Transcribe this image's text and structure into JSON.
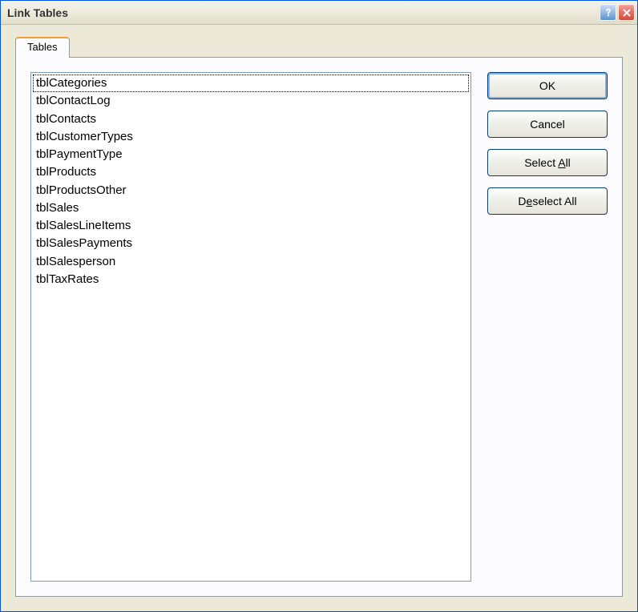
{
  "window": {
    "title": "Link Tables"
  },
  "tabs": {
    "items": [
      {
        "label": "Tables"
      }
    ]
  },
  "list": {
    "items": [
      "tblCategories",
      "tblContactLog",
      "tblContacts",
      "tblCustomerTypes",
      "tblPaymentType",
      "tblProducts",
      "tblProductsOther",
      "tblSales",
      "tblSalesLineItems",
      "tblSalesPayments",
      "tblSalesperson",
      "tblTaxRates"
    ],
    "focused_index": 0
  },
  "buttons": {
    "ok": "OK",
    "cancel": "Cancel",
    "select_all_pre": "Select ",
    "select_all_u": "A",
    "select_all_post": "ll",
    "deselect_all_pre": "D",
    "deselect_all_u": "e",
    "deselect_all_post": "select All"
  }
}
